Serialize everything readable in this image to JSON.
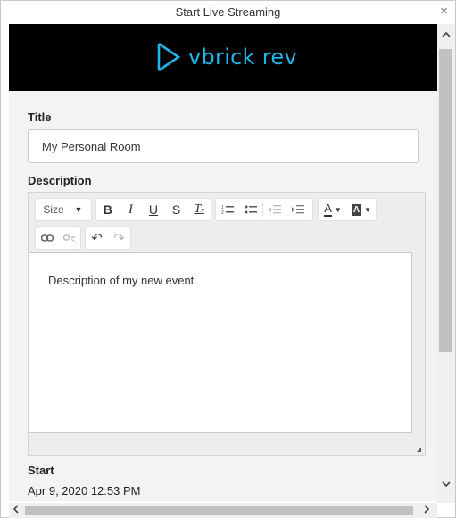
{
  "window": {
    "title": "Start Live Streaming",
    "close_glyph": "×"
  },
  "banner": {
    "logo_text": "vbrick rev",
    "logo_icon": "play-triangle-logo",
    "accent": "#1fb5e8"
  },
  "form": {
    "title_label": "Title",
    "title_value": "My Personal Room",
    "description_label": "Description",
    "description_text": "Description of my new event.",
    "start_label": "Start",
    "start_value": "Apr 9, 2020 12:53 PM"
  },
  "toolbar": {
    "size_label": "Size",
    "bold": "B",
    "italic": "I",
    "underline": "U",
    "strike": "S",
    "clear_format": "T",
    "font_color": "A",
    "bg_color": "A"
  },
  "scrollbars": {
    "up": "^",
    "down": "v",
    "left": "<",
    "right": ">"
  }
}
